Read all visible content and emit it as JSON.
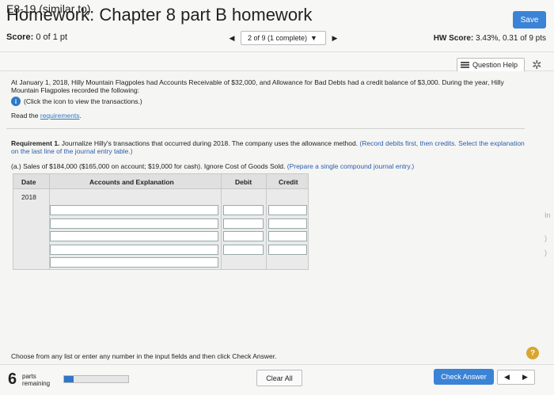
{
  "header": {
    "title": "Homework: Chapter 8 part B homework",
    "save_label": "Save",
    "score_label": "Score:",
    "score_value": "0 of 1 pt",
    "pager_text": "2 of 9 (1 complete)",
    "hw_score_label": "HW Score:",
    "hw_score_value": "3.43%, 0.31 of 9 pts"
  },
  "question": {
    "id": "E8-19 (similar to)",
    "help_label": "Question Help",
    "intro": "At January 1, 2018, Hilly Mountain Flagpoles had Accounts Receivable of $32,000, and Allowance for Bad Debts had a credit balance of $3,000. During the year, Hilly Mountain Flagpoles recorded the following:",
    "info_text": "(Click the icon to view the transactions.)",
    "read_prefix": "Read the",
    "read_link": "requirements",
    "read_suffix": ".",
    "req_label": "Requirement 1.",
    "req_text": "Journalize Hilly's transactions that occurred during 2018. The company uses the allowance method.",
    "req_note": "(Record debits first, then credits. Select the explanation on the last line of the journal entry table.)",
    "part_a": "(a.) Sales of $184,000 ($165,000 on account; $19,000 for cash). Ignore Cost of Goods Sold.",
    "part_a_note": "(Prepare a single compound journal entry.)"
  },
  "journal": {
    "headers": [
      "Date",
      "Accounts and Explanation",
      "Debit",
      "Credit"
    ],
    "year": "2018",
    "rows": 5
  },
  "footer": {
    "instruction": "Choose from any list or enter any number in the input fields and then click Check Answer.",
    "parts_count": "6",
    "parts_label_1": "parts",
    "parts_label_2": "remaining",
    "progress_fraction": 0.15,
    "clear_label": "Clear All",
    "check_label": "Check Answer"
  },
  "edge_glyphs": [
    "In",
    ")",
    ")"
  ]
}
